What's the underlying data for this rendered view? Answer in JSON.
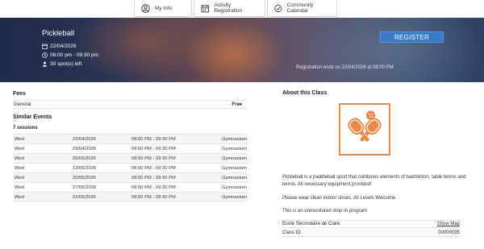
{
  "nav": {
    "my_info": "My Info",
    "activity_registration": "Activity Registration",
    "community_calendar": "Community Calendar"
  },
  "banner": {
    "title": "Pickleball",
    "date": "22/04/2026",
    "time": "08:00 pm - 09:30 pm",
    "spots": "30 spot(s) left",
    "register_label": "REGISTER",
    "registration_ends": "Registration ends on 22/04/2026 at 08:00 PM"
  },
  "fees": {
    "heading": "Fees",
    "rows": [
      {
        "label": "General",
        "price": "Free"
      }
    ]
  },
  "similar": {
    "heading": "Similar Events",
    "sessions_label": "7 sessions",
    "rows": [
      {
        "day": "Wed",
        "date": "22/04/2026",
        "time": "08:00 PM - 09:30 PM",
        "room": "Gymnasium"
      },
      {
        "day": "Wed",
        "date": "29/04/2026",
        "time": "08:00 PM - 09:30 PM",
        "room": "Gymnasium"
      },
      {
        "day": "Wed",
        "date": "06/05/2026",
        "time": "08:00 PM - 09:30 PM",
        "room": "Gymnasium"
      },
      {
        "day": "Wed",
        "date": "13/05/2026",
        "time": "08:00 PM - 09:30 PM",
        "room": "Gymnasium"
      },
      {
        "day": "Wed",
        "date": "20/05/2026",
        "time": "08:00 PM - 09:30 PM",
        "room": "Gymnasium"
      },
      {
        "day": "Wed",
        "date": "27/05/2026",
        "time": "08:00 PM - 09:30 PM",
        "room": "Gymnasium"
      },
      {
        "day": "Wed",
        "date": "03/06/2026",
        "time": "08:00 PM - 09:30 PM",
        "room": "Gymnasium"
      }
    ]
  },
  "about": {
    "heading": "About this Class",
    "description": "Pickleball is a paddleball sport that combines elements of badminton, table tennis and tennis. All necessary equipment provided!",
    "note": "Please wear clean indoor shoes. All Levels Welcome.",
    "dropin": "This is an unmonitored drop-in program",
    "location": "Ecole Secondaire de Clare",
    "show_map": "Show Map",
    "class_id_label": "Class ID",
    "class_id": "00000095"
  },
  "icons": {
    "my_info": "user-circle-icon",
    "activity_registration": "calendar-grid-icon",
    "community_calendar": "calendar-check-icon",
    "date": "calendar-icon",
    "time": "clock-icon",
    "spots": "person-icon",
    "class_logo": "pickleball-paddles-icon"
  },
  "colors": {
    "accent": "#3a7bc8",
    "logo_orange": "#e8894a"
  }
}
